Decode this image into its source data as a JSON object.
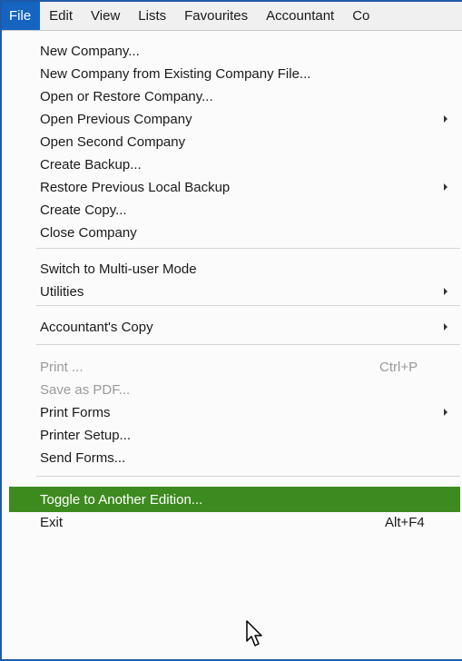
{
  "menubar": {
    "items": [
      {
        "label": "File"
      },
      {
        "label": "Edit"
      },
      {
        "label": "View"
      },
      {
        "label": "Lists"
      },
      {
        "label": "Favourites"
      },
      {
        "label": "Accountant"
      },
      {
        "label": "Co"
      }
    ]
  },
  "file_menu": {
    "items": [
      {
        "label": "New Company...",
        "submenu": false,
        "enabled": true
      },
      {
        "label": "New Company from Existing Company File...",
        "submenu": false,
        "enabled": true
      },
      {
        "label": "Open or Restore Company...",
        "submenu": false,
        "enabled": true
      },
      {
        "label": "Open Previous Company",
        "submenu": true,
        "enabled": true
      },
      {
        "label": "Open Second Company",
        "submenu": false,
        "enabled": true
      },
      {
        "label": "Create Backup...",
        "submenu": false,
        "enabled": true
      },
      {
        "label": "Restore Previous Local Backup",
        "submenu": true,
        "enabled": true
      },
      {
        "label": "Create Copy...",
        "submenu": false,
        "enabled": true
      },
      {
        "label": "Close Company",
        "submenu": false,
        "enabled": true
      },
      {
        "label": "Switch to Multi-user Mode",
        "submenu": false,
        "enabled": true
      },
      {
        "label": "Utilities",
        "submenu": true,
        "enabled": true
      },
      {
        "label": "Accountant's Copy",
        "submenu": true,
        "enabled": true
      },
      {
        "label": "Print ...",
        "shortcut": "Ctrl+P",
        "submenu": false,
        "enabled": false
      },
      {
        "label": "Save as PDF...",
        "submenu": false,
        "enabled": false
      },
      {
        "label": "Print Forms",
        "submenu": true,
        "enabled": true
      },
      {
        "label": "Printer Setup...",
        "submenu": false,
        "enabled": true
      },
      {
        "label": "Send Forms...",
        "submenu": false,
        "enabled": true
      },
      {
        "label": "Toggle to Another Edition...",
        "submenu": false,
        "enabled": true,
        "highlighted": true
      },
      {
        "label": "Exit",
        "shortcut": "Alt+F4",
        "submenu": false,
        "enabled": true
      }
    ]
  },
  "colors": {
    "active_menubar_bg": "#1464c0",
    "highlight_bg": "#3d8a1e",
    "disabled_text": "#9a9a9a"
  },
  "icons": {
    "cursor": "mouse-pointer-icon",
    "submenu": "submenu-arrow-icon"
  }
}
